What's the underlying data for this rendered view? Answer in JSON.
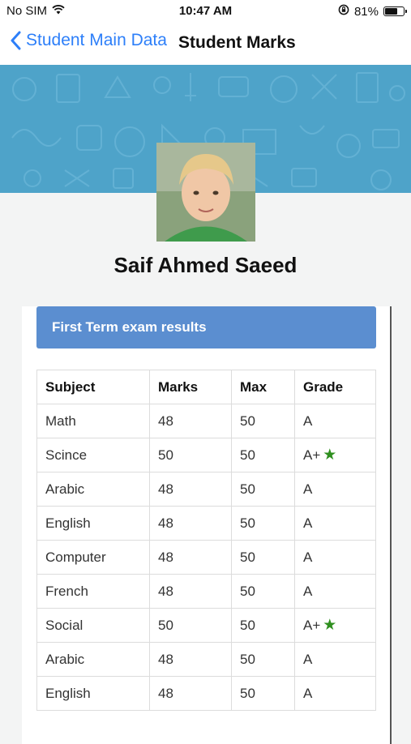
{
  "status_bar": {
    "carrier": "No SIM",
    "time": "10:47 AM",
    "battery": "81%",
    "battery_level": 0.81
  },
  "nav": {
    "back_label": "Student Main Data",
    "title": "Student Marks"
  },
  "student": {
    "name": "Saif Ahmed Saeed"
  },
  "term": {
    "title": "First Term exam results"
  },
  "table": {
    "headers": [
      "Subject",
      "Marks",
      "Max",
      "Grade"
    ],
    "rows": [
      {
        "subject": "Math",
        "marks": "48",
        "max": "50",
        "grade": "A",
        "star": false
      },
      {
        "subject": "Scince",
        "marks": "50",
        "max": "50",
        "grade": "A+",
        "star": true
      },
      {
        "subject": "Arabic",
        "marks": "48",
        "max": "50",
        "grade": "A",
        "star": false
      },
      {
        "subject": "English",
        "marks": "48",
        "max": "50",
        "grade": "A",
        "star": false
      },
      {
        "subject": "Computer",
        "marks": "48",
        "max": "50",
        "grade": "A",
        "star": false
      },
      {
        "subject": "French",
        "marks": "48",
        "max": "50",
        "grade": "A",
        "star": false
      },
      {
        "subject": "Social",
        "marks": "50",
        "max": "50",
        "grade": "A+",
        "star": true
      },
      {
        "subject": "Arabic",
        "marks": "48",
        "max": "50",
        "grade": "A",
        "star": false
      },
      {
        "subject": "English",
        "marks": "48",
        "max": "50",
        "grade": "A",
        "star": false
      }
    ]
  },
  "icons": {
    "star": "star-icon",
    "back": "chevron-left-icon",
    "wifi": "wifi-icon",
    "lock": "rotation-lock-icon",
    "battery": "battery-icon"
  },
  "colors": {
    "accent": "#2d7ff9",
    "banner": "#4ea3c9",
    "term_header": "#5b8ed0",
    "star": "#2f8f1f"
  }
}
